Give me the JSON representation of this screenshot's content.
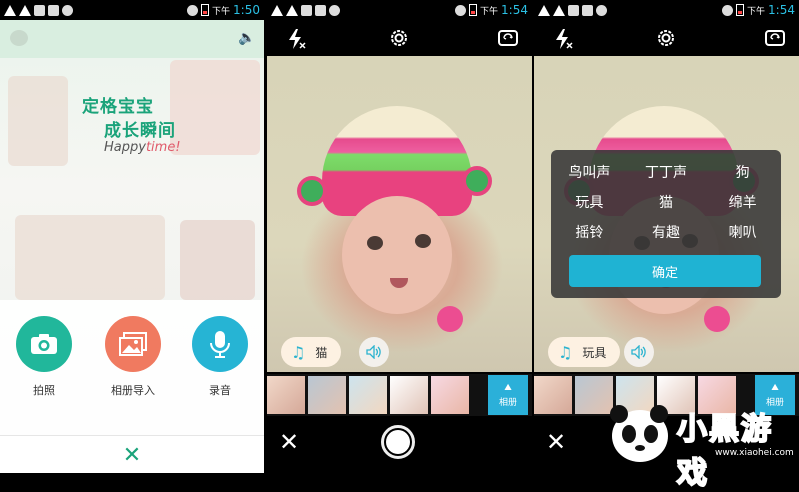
{
  "status_times": [
    "1:50",
    "1:54",
    "1:54"
  ],
  "status_ampm": "下午",
  "panel1": {
    "title_line1": "定格宝宝",
    "title_line2": "成长瞬间",
    "title_line3_a": "Happy",
    "title_line3_b": "time!",
    "actions": [
      {
        "label": "拍照",
        "color": "#21b79b",
        "icon": "camera-icon"
      },
      {
        "label": "相册导入",
        "color": "#f07a60",
        "icon": "gallery-icon"
      },
      {
        "label": "录音",
        "color": "#26b4d4",
        "icon": "microphone-icon"
      }
    ],
    "close_label": "✕"
  },
  "panel2": {
    "sound_label": "猫",
    "album_label": "相册"
  },
  "panel3": {
    "sound_label": "玩具",
    "album_label": "相册",
    "dialog": {
      "options": [
        "鸟叫声",
        "丁丁声",
        "狗",
        "玩具",
        "猫",
        "绵羊",
        "摇铃",
        "有趣",
        "喇叭"
      ],
      "confirm": "确定"
    }
  },
  "watermark": {
    "brand": "小黑游戏",
    "url": "www.xiaohei.com"
  }
}
